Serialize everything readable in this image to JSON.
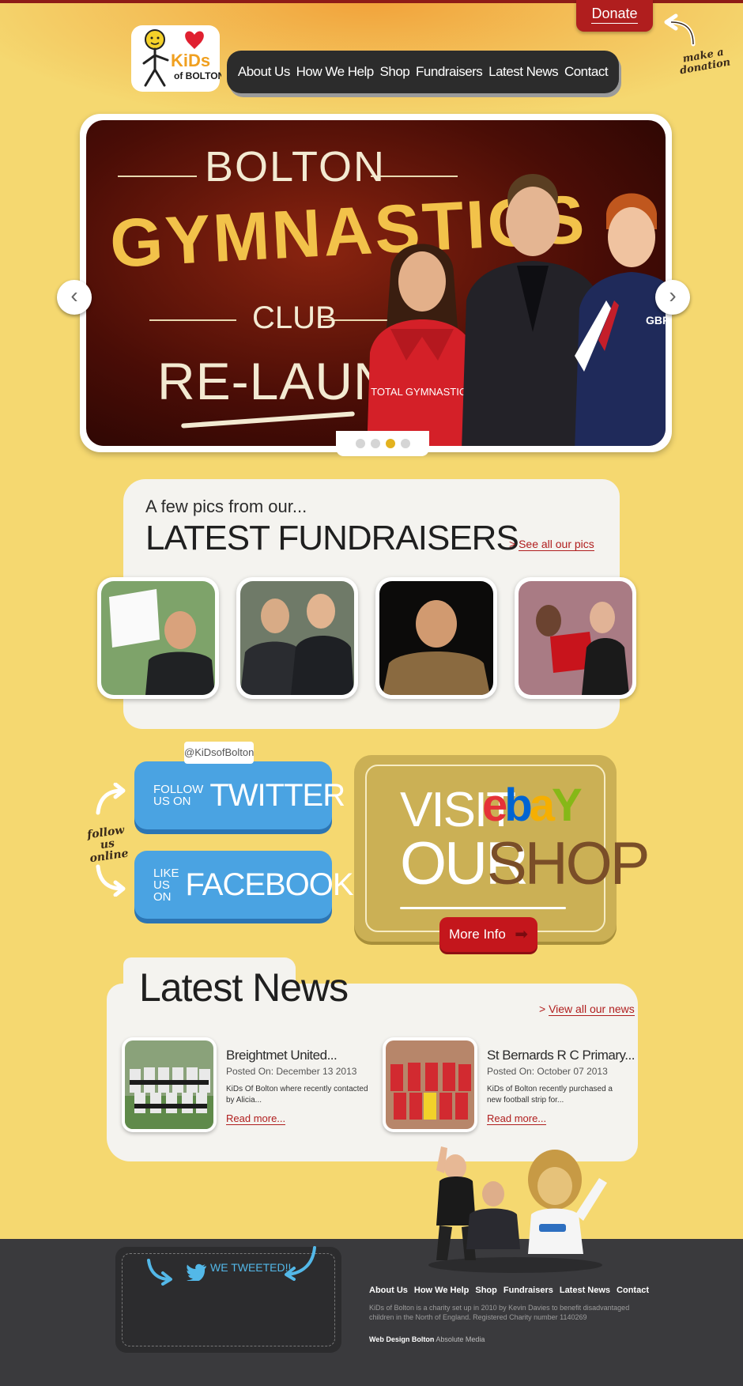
{
  "header": {
    "donate_label": "Donate",
    "donate_note": "make a donation",
    "logo_text_top": "KiDs",
    "logo_text_bottom": "of BOLTON",
    "nav": [
      "About Us",
      "How We Help",
      "Shop",
      "Fundraisers",
      "Latest News",
      "Contact"
    ]
  },
  "slider": {
    "line1": "BOLTON",
    "line2": "GYMNASTICS",
    "line3": "CLUB",
    "line4": "RE-LAUNCH!!",
    "prev_icon": "chevron-left-icon",
    "next_icon": "chevron-right-icon",
    "slide_count": 4,
    "active_slide": 3,
    "hoodie_text": "TOTAL GYMNASTICS",
    "jacket_text": "GBR"
  },
  "fundraisers": {
    "kicker": "A few pics from our...",
    "title": "LATEST FUNDRAISERS",
    "link": "See all our pics"
  },
  "social": {
    "follow_note": "follow us online",
    "twitter_handle": "@KiDsofBolton",
    "twitter_small": "FOLLOW US ON",
    "twitter_big": "TWITTER",
    "facebook_small": "LIKE US ON",
    "facebook_big": "FACEBOOK"
  },
  "shop": {
    "visit": "VISIT",
    "our": "OUR",
    "shop": "SHOP",
    "more_info": "More Info"
  },
  "news": {
    "title": "Latest News",
    "view_all": "View all our news",
    "items": [
      {
        "headline": "Breightmet United...",
        "date": "Posted On: December 13 2013",
        "excerpt": "KiDs Of Bolton where recently contacted by Alicia...",
        "more": "Read more..."
      },
      {
        "headline": "St Bernards R C Primary...",
        "date": "Posted On: October 07 2013",
        "excerpt": "KiDs of Bolton recently purchased a new football strip for...",
        "more": "Read more..."
      }
    ]
  },
  "footer": {
    "tweet_label": "WE TWEETED!!",
    "nav": [
      "About Us",
      "How We Help",
      "Shop",
      "Fundraisers",
      "Latest News",
      "Contact"
    ],
    "about": "KiDs of Bolton is a charity set up in 2010 by Kevin Davies to benefit disadvantaged children in the North of England. Registered Charity number 1140269",
    "credit_bold": "Web Design Bolton",
    "credit_rest": "Absolute Media"
  },
  "colors": {
    "background": "#f5d870",
    "accent_red": "#b01e1e",
    "nav_dark": "#2c2c2c",
    "social_blue": "#4aa3e2",
    "footer": "#3a3a3d"
  }
}
